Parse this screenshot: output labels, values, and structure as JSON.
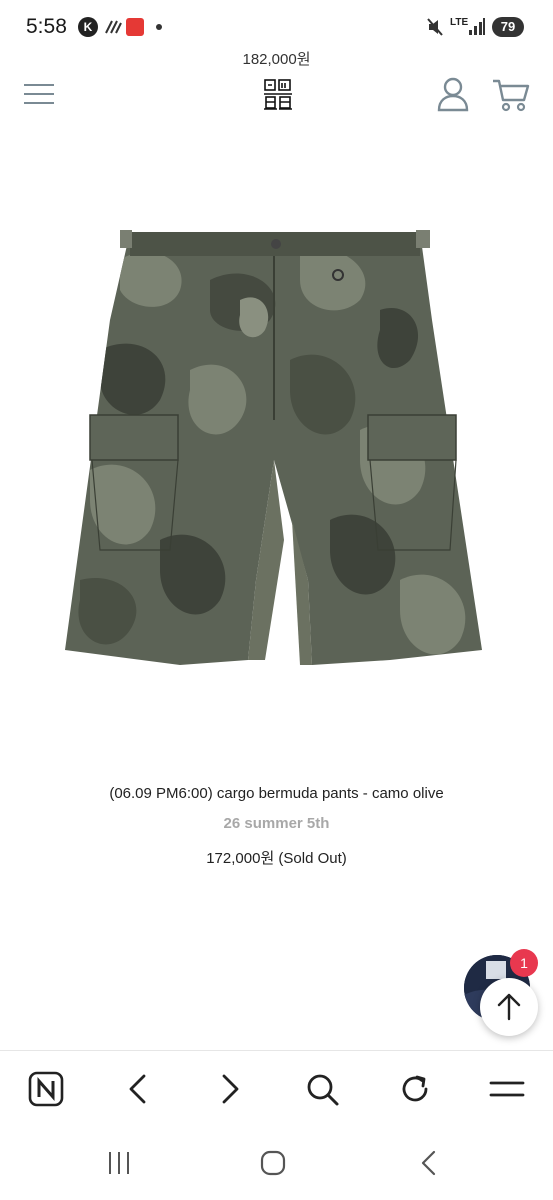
{
  "status_bar": {
    "time": "5:58",
    "network": "LTE",
    "battery": "79",
    "app_k_label": "K"
  },
  "header": {
    "previous_item_price": "182,000원",
    "menu_icon": "hamburger-menu-icon",
    "logo_icon": "brand-logo",
    "account_icon": "user-icon",
    "cart_icon": "cart-icon"
  },
  "product": {
    "image_icon": "camo-cargo-shorts-photo",
    "name": "(06.09 PM6:00) cargo bermuda pants - camo olive",
    "collection": "26 summer 5th",
    "price": "172,000원 (Sold Out)"
  },
  "floating": {
    "chat_badge_count": "1",
    "scroll_top_icon": "arrow-up-icon"
  },
  "browser_toolbar": {
    "home_icon": "naver-n-icon",
    "back_icon": "chevron-left-icon",
    "forward_icon": "chevron-right-icon",
    "search_icon": "search-icon",
    "reload_icon": "reload-icon",
    "menu_icon": "menu-lines-icon"
  },
  "android_nav": {
    "recents_icon": "recents-icon",
    "home_icon": "home-icon",
    "back_icon": "back-icon"
  },
  "colors": {
    "accent_badge": "#e8384f",
    "icon_gray": "#7a8a94",
    "collection_text": "#a8a8a8"
  }
}
